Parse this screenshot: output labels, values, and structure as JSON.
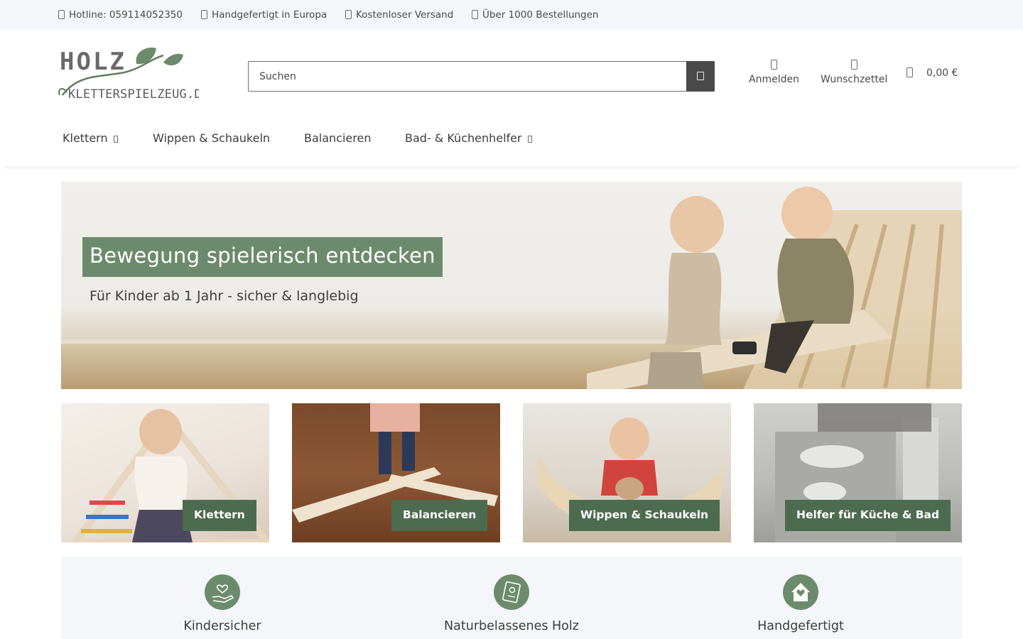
{
  "topbar": {
    "items": [
      {
        "icon": "phone-icon",
        "label": "Hotline: 059114052350"
      },
      {
        "icon": "hand-icon",
        "label": "Handgefertigt in Europa"
      },
      {
        "icon": "truck-icon",
        "label": "Kostenloser Versand"
      },
      {
        "icon": "star-icon",
        "label": "Über 1000 Bestellungen"
      }
    ]
  },
  "header": {
    "logo": {
      "line1": "HOLZ",
      "line2": "KLETTERSPIELZEUG.DE"
    },
    "search": {
      "placeholder": "Suchen",
      "value": ""
    },
    "login_label": "Anmelden",
    "wishlist_label": "Wunschzettel",
    "cart_total": "0,00 €"
  },
  "nav": {
    "items": [
      {
        "label": "Klettern",
        "has_dropdown": true
      },
      {
        "label": "Wippen & Schaukeln",
        "has_dropdown": false
      },
      {
        "label": "Balancieren",
        "has_dropdown": false
      },
      {
        "label": "Bad- & Küchenhelfer",
        "has_dropdown": true
      }
    ]
  },
  "hero": {
    "title": "Bewegung spielerisch entdecken",
    "subtitle": "Für Kinder ab 1 Jahr - sicher & langlebig"
  },
  "categories": [
    {
      "label": "Klettern"
    },
    {
      "label": "Balancieren"
    },
    {
      "label": "Wippen & Schaukeln"
    },
    {
      "label": "Helfer für Küche & Bad"
    }
  ],
  "features": [
    {
      "icon": "hand-heart-icon",
      "title": "Kindersicher"
    },
    {
      "icon": "certificate-icon",
      "title": "Naturbelassenes Holz"
    },
    {
      "icon": "house-heart-icon",
      "title": "Handgefertigt"
    }
  ],
  "colors": {
    "accent_green": "#6c8b6c",
    "label_green": "#4d6b4f",
    "topbar_bg": "#f4f6fa",
    "search_button": "#4a4a4a"
  }
}
